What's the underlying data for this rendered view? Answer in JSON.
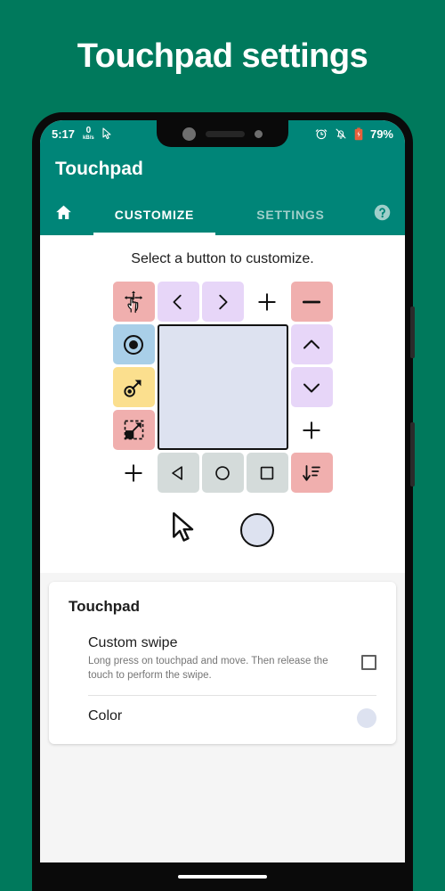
{
  "page": {
    "title": "Touchpad settings",
    "background_color": "#00795c"
  },
  "statusbar": {
    "time": "5:17",
    "net_speed_value": "0",
    "net_speed_unit": "kB/s",
    "cursor_icon": "cursor-icon",
    "alarm_icon": "alarm-icon",
    "mute_icon": "bell-muted-icon",
    "battery_icon": "battery-icon",
    "battery_percent": "79%",
    "background_color": "#008578"
  },
  "appbar": {
    "title": "Touchpad",
    "background_color": "#008578",
    "home_icon": "home-icon",
    "help_icon": "help-circle-icon"
  },
  "tabs": [
    {
      "label": "CUSTOMIZE",
      "active": true
    },
    {
      "label": "SETTINGS",
      "active": false
    }
  ],
  "customize": {
    "hint": "Select a button to customize.",
    "touchpad_surface": {
      "name": "touchpad-surface",
      "color": "#dde2f0"
    },
    "buttons": [
      {
        "name": "pan-gesture-button",
        "icon": "hand-pan-icon",
        "color": "#f0afae",
        "row": 1,
        "col": 1
      },
      {
        "name": "prev-button",
        "icon": "chevron-left-icon",
        "color": "#e7d6f8",
        "row": 1,
        "col": 2
      },
      {
        "name": "next-button",
        "icon": "chevron-right-icon",
        "color": "#e7d6f8",
        "row": 1,
        "col": 3
      },
      {
        "name": "add-button-top",
        "icon": "plus-icon",
        "color": "transparent",
        "row": 1,
        "col": 4
      },
      {
        "name": "volume-down-button",
        "icon": "minus-icon",
        "color": "#f0afae",
        "row": 1,
        "col": 5
      },
      {
        "name": "tap-button",
        "icon": "tap-target-icon",
        "color": "#a9cfe8",
        "row": 2,
        "col": 1
      },
      {
        "name": "scroll-up-button",
        "icon": "chevron-up-icon",
        "color": "#e7d6f8",
        "row": 2,
        "col": 5
      },
      {
        "name": "drag-button",
        "icon": "drag-arrow-icon",
        "color": "#fbdf8e",
        "row": 3,
        "col": 1
      },
      {
        "name": "scroll-down-button",
        "icon": "chevron-down-icon",
        "color": "#e7d6f8",
        "row": 3,
        "col": 5
      },
      {
        "name": "resize-button",
        "icon": "resize-icon",
        "color": "#f0afae",
        "row": 4,
        "col": 1
      },
      {
        "name": "add-button-right",
        "icon": "plus-icon",
        "color": "transparent",
        "row": 4,
        "col": 5
      },
      {
        "name": "add-button-bottom",
        "icon": "plus-icon",
        "color": "transparent",
        "row": 5,
        "col": 1
      },
      {
        "name": "nav-back-button",
        "icon": "triangle-back-icon",
        "color": "#d4dbda",
        "row": 5,
        "col": 2
      },
      {
        "name": "nav-home-button",
        "icon": "circle-home-icon",
        "color": "#d4dbda",
        "row": 5,
        "col": 3
      },
      {
        "name": "nav-recents-button",
        "icon": "square-recents-icon",
        "color": "#d4dbda",
        "row": 5,
        "col": 4
      },
      {
        "name": "sort-button",
        "icon": "sort-descending-icon",
        "color": "#f0afae",
        "row": 5,
        "col": 5
      }
    ],
    "pointer_preview": {
      "cursor_icon": "mouse-pointer-icon",
      "touch_indicator": "touch-circle-indicator",
      "touch_color": "#dde2f0"
    }
  },
  "settings_card": {
    "title": "Touchpad",
    "rows": [
      {
        "label": "Custom swipe",
        "description": "Long press on touchpad and move. Then release the touch to perform the swipe.",
        "control": "checkbox",
        "checked": false
      },
      {
        "label": "Color",
        "control": "color-swatch",
        "value": "#dde2f0"
      }
    ]
  },
  "navigation": {
    "gesture_bar": "gesture-handle"
  }
}
